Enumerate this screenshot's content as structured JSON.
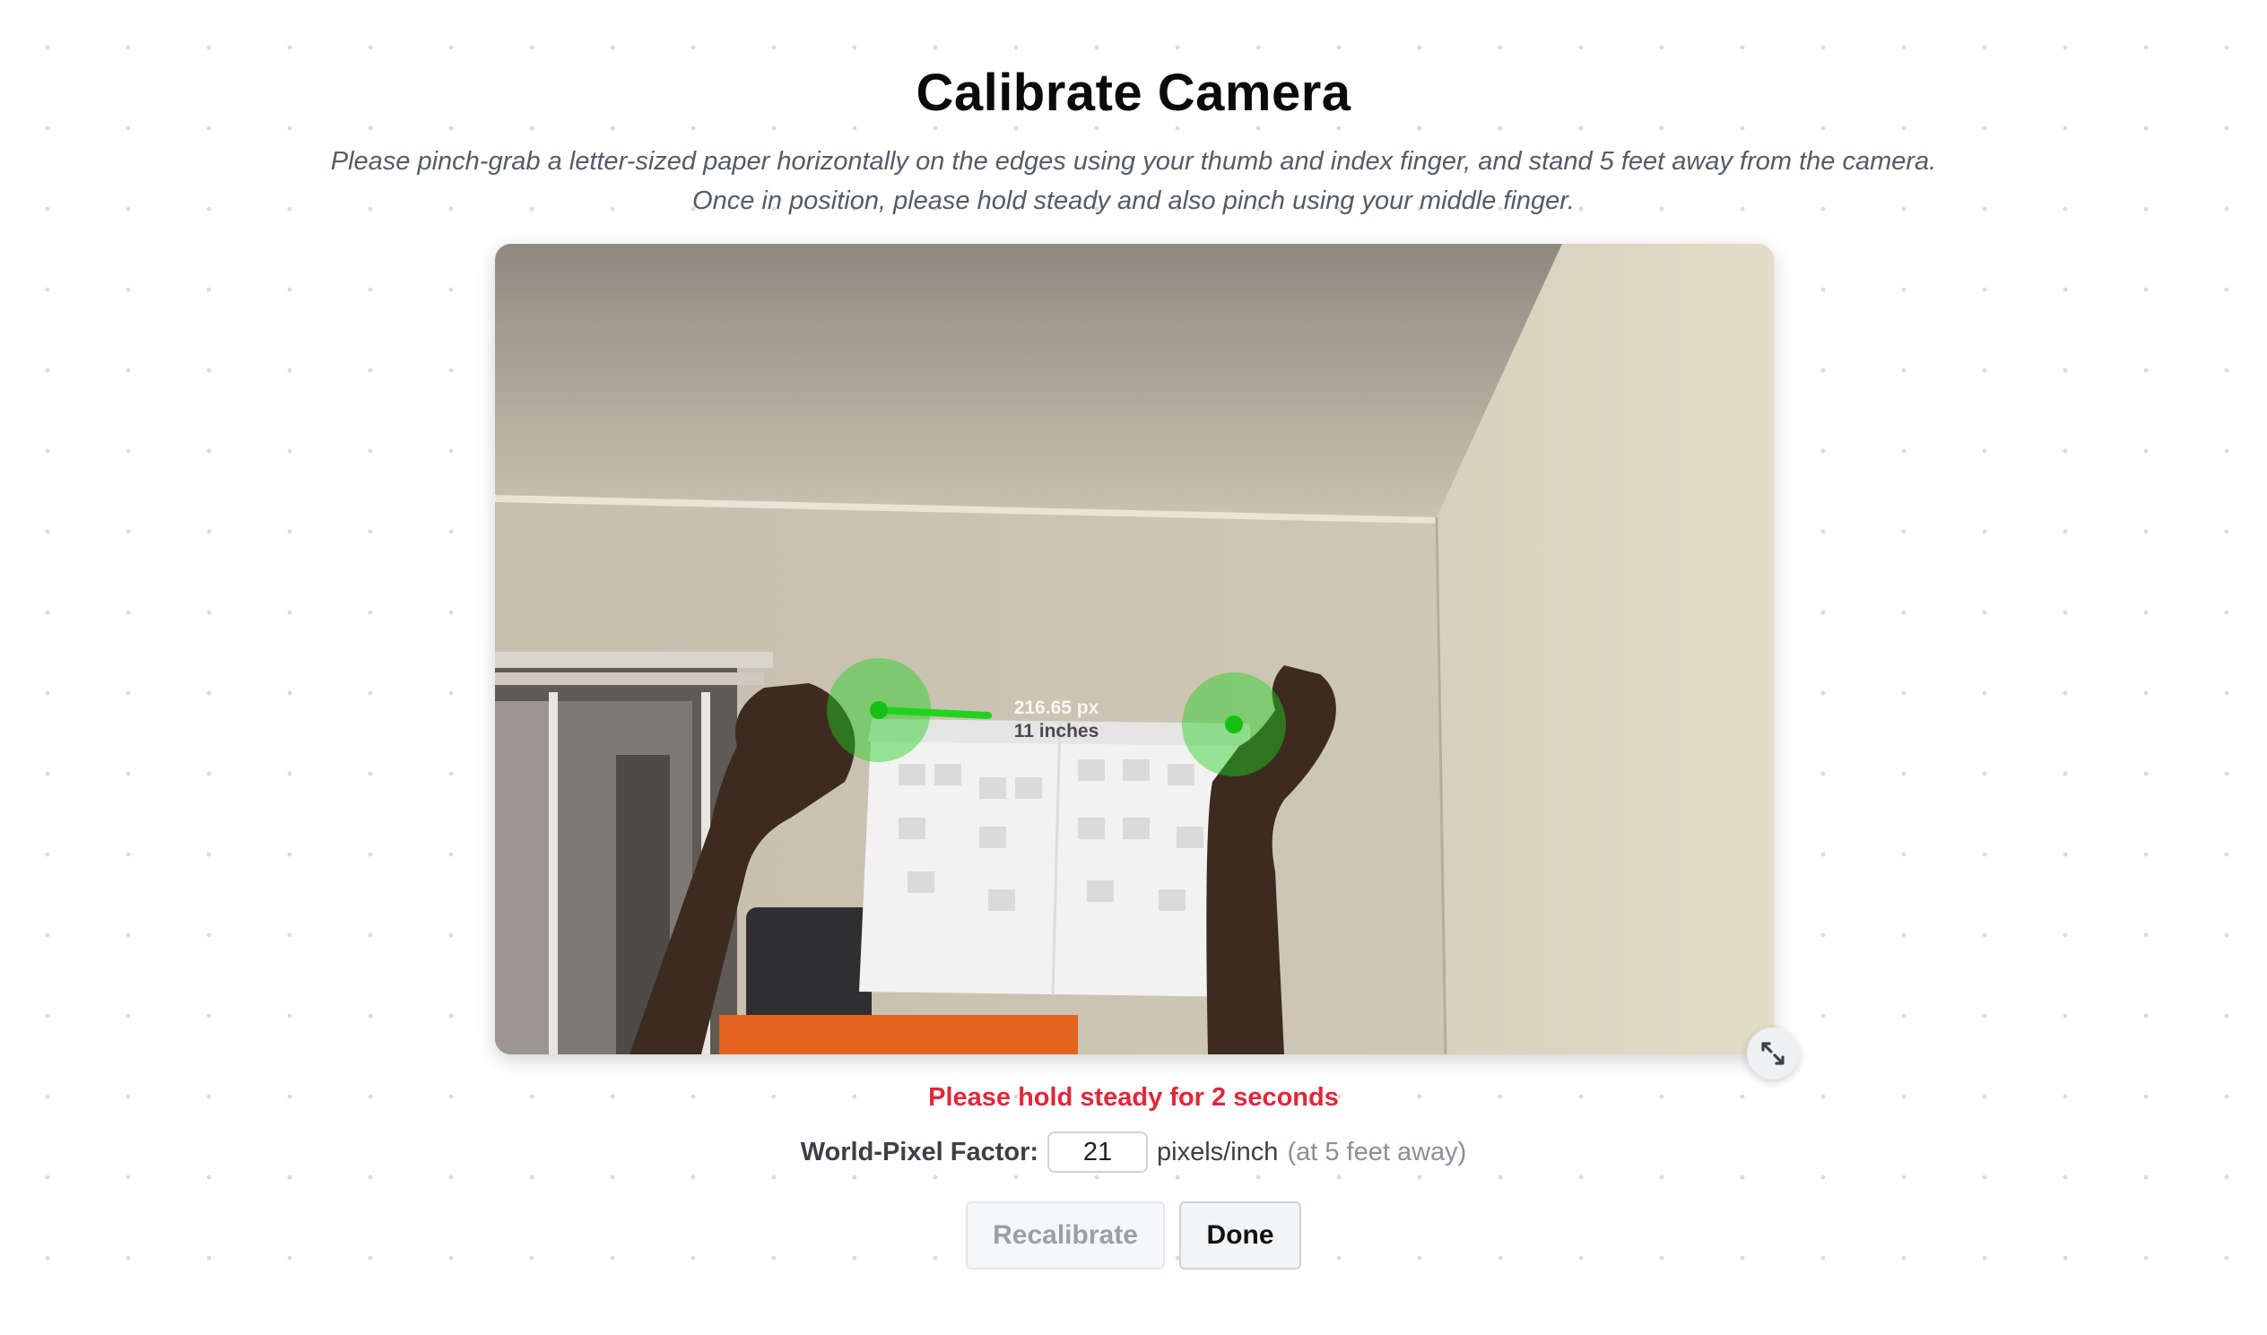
{
  "header": {
    "title": "Calibrate Camera",
    "subtitle_line1": "Please pinch-grab a letter-sized paper horizontally on the edges using your thumb and index finger, and stand 5 feet away from the camera.",
    "subtitle_line2": "Once in position, please hold steady and also pinch using your middle finger."
  },
  "camera": {
    "measurement_px": "216.65 px",
    "measurement_inches": "11 inches",
    "marker_color": "#22d11f"
  },
  "status": {
    "message": "Please hold steady for 2 seconds",
    "color": "#e0273a"
  },
  "calibration": {
    "label": "World-Pixel Factor:",
    "value": "21",
    "unit": "pixels/inch",
    "note": "(at 5 feet away)"
  },
  "actions": {
    "recalibrate_label": "Recalibrate",
    "done_label": "Done"
  }
}
